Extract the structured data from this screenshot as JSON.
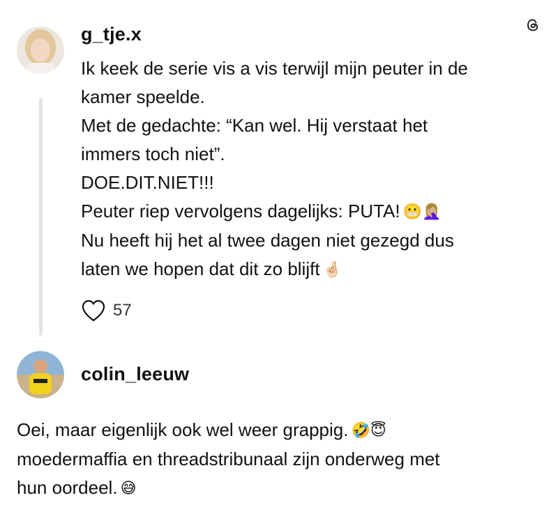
{
  "post": {
    "username": "g_tje.x",
    "lines": [
      "Ik keek de serie vis a vis terwijl mijn peuter in de",
      "kamer speelde.",
      "Met de gedachte: “Kan wel. Hij verstaat het",
      "immers toch niet”.",
      "DOE.DIT.NIET!!!",
      "Peuter riep vervolgens dagelijks: PUTA!",
      "Nu heeft hij het al twee dagen niet gezegd dus",
      "laten we hopen dat dit zo blijft"
    ],
    "emoji_line6": "😬🤦🏼‍♀️",
    "emoji_line8": "🤞🏻",
    "like_count": "57"
  },
  "reply": {
    "username": "colin_leeuw",
    "lines": [
      "Oei, maar eigenlijk ook wel weer grappig.",
      "moedermaffia en threadstribunaal zijn onderweg met",
      "hun oordeel."
    ],
    "emoji_line1": "🤣😇",
    "emoji_line3": "😅"
  },
  "icons": {
    "threads_logo": "threads-logo-icon",
    "like": "heart-outline-icon"
  },
  "colors": {
    "text": "#111111",
    "thread_line": "#e3e3e3",
    "muted": "#333333"
  }
}
